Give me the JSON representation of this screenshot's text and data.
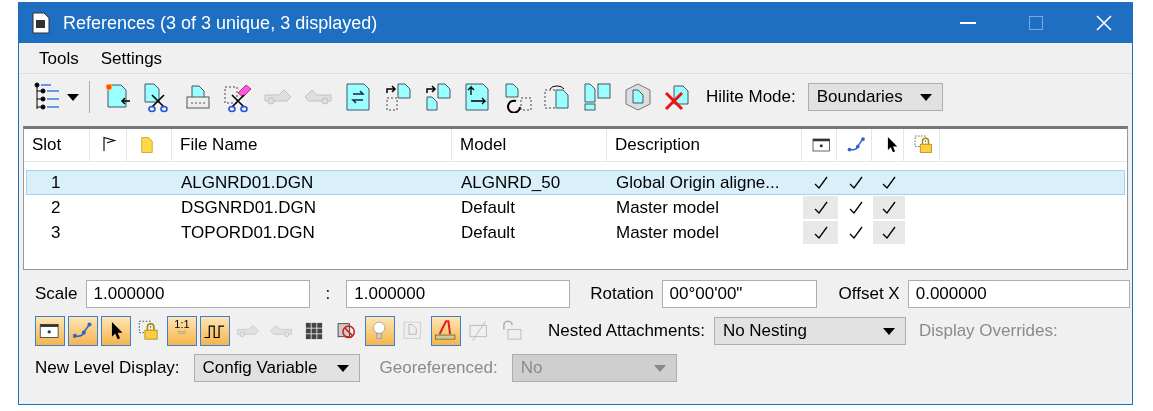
{
  "window": {
    "title": "References (3 of 3 unique, 3 displayed)"
  },
  "menu": [
    {
      "label": "Tools"
    },
    {
      "label": "Settings"
    }
  ],
  "toolbar": {
    "buttons": [
      {
        "kind": "attach",
        "disabled": false
      },
      {
        "kind": "detach",
        "disabled": false
      },
      {
        "kind": "print",
        "disabled": false
      },
      {
        "kind": "erase",
        "disabled": false
      },
      {
        "kind": "car-right",
        "disabled": true
      },
      {
        "kind": "car-left",
        "disabled": true
      },
      {
        "kind": "swap",
        "disabled": false
      },
      {
        "kind": "copy-out",
        "disabled": false
      },
      {
        "kind": "copy-in",
        "disabled": false
      },
      {
        "kind": "move",
        "disabled": false
      },
      {
        "kind": "rotate",
        "disabled": false
      },
      {
        "kind": "mirror",
        "disabled": false
      },
      {
        "kind": "clip",
        "disabled": false
      },
      {
        "kind": "cube",
        "disabled": false
      },
      {
        "kind": "delete",
        "disabled": false
      }
    ],
    "hilite_mode": {
      "label": "Hilite Mode:",
      "value": "Boundaries"
    }
  },
  "table": {
    "columns": [
      {
        "kind": "text",
        "label": "Slot"
      },
      {
        "kind": "flag"
      },
      {
        "kind": "document"
      },
      {
        "kind": "text",
        "label": "File Name"
      },
      {
        "kind": "text",
        "label": "Model"
      },
      {
        "kind": "text",
        "label": "Description"
      },
      {
        "kind": "display"
      },
      {
        "kind": "snap"
      },
      {
        "kind": "locate"
      },
      {
        "kind": "lock"
      }
    ],
    "rows": [
      {
        "slot": "1",
        "file_name": "ALGNRD01.DGN",
        "model": "ALGNRD_50",
        "description": "Global Origin aligne...",
        "display": true,
        "snap": true,
        "locate": true,
        "lock": false,
        "selected": true
      },
      {
        "slot": "2",
        "file_name": "DSGNRD01.DGN",
        "model": "Default",
        "description": "Master model",
        "display": true,
        "snap": true,
        "locate": true,
        "lock": false,
        "selected": false
      },
      {
        "slot": "3",
        "file_name": "TOPORD01.DGN",
        "model": "Default",
        "description": "Master model",
        "display": true,
        "snap": true,
        "locate": true,
        "lock": false,
        "selected": false
      }
    ]
  },
  "scale": {
    "label": "Scale",
    "value": "1.000000",
    "separator": ":",
    "value_2": "1.000000"
  },
  "rotation": {
    "label": "Rotation",
    "value": "00°00'00\""
  },
  "offset_x": {
    "label": "Offset X",
    "value": "0.000000"
  },
  "toggles": [
    {
      "kind": "display",
      "on": true,
      "disabled": false
    },
    {
      "kind": "snap",
      "on": true,
      "disabled": false
    },
    {
      "kind": "locate",
      "on": true,
      "disabled": false
    },
    {
      "kind": "lock",
      "on": false,
      "disabled": false
    },
    {
      "kind": "scale",
      "label": "1:1",
      "on": true,
      "disabled": false
    },
    {
      "kind": "linestyle",
      "on": true,
      "disabled": false
    },
    {
      "kind": "car-right",
      "on": false,
      "disabled": true
    },
    {
      "kind": "car-left",
      "on": false,
      "disabled": true
    },
    {
      "kind": "grid",
      "on": false,
      "disabled": false
    },
    {
      "kind": "no-raster",
      "on": false,
      "disabled": false
    },
    {
      "kind": "bulb",
      "on": true,
      "disabled": false
    },
    {
      "kind": "frame",
      "on": false,
      "disabled": true
    },
    {
      "kind": "text",
      "on": true,
      "disabled": false
    },
    {
      "kind": "slash",
      "on": false,
      "disabled": true
    },
    {
      "kind": "unlock",
      "on": false,
      "disabled": true
    }
  ],
  "nested_attachments": {
    "label": "Nested Attachments:",
    "value": "No Nesting"
  },
  "display_overrides": {
    "label": "Display Overrides:",
    "disabled": true
  },
  "new_level_display": {
    "label": "New Level Display:",
    "value": "Config Variable"
  },
  "georeferenced": {
    "label": "Georeferenced:",
    "value": "No",
    "disabled": true
  }
}
